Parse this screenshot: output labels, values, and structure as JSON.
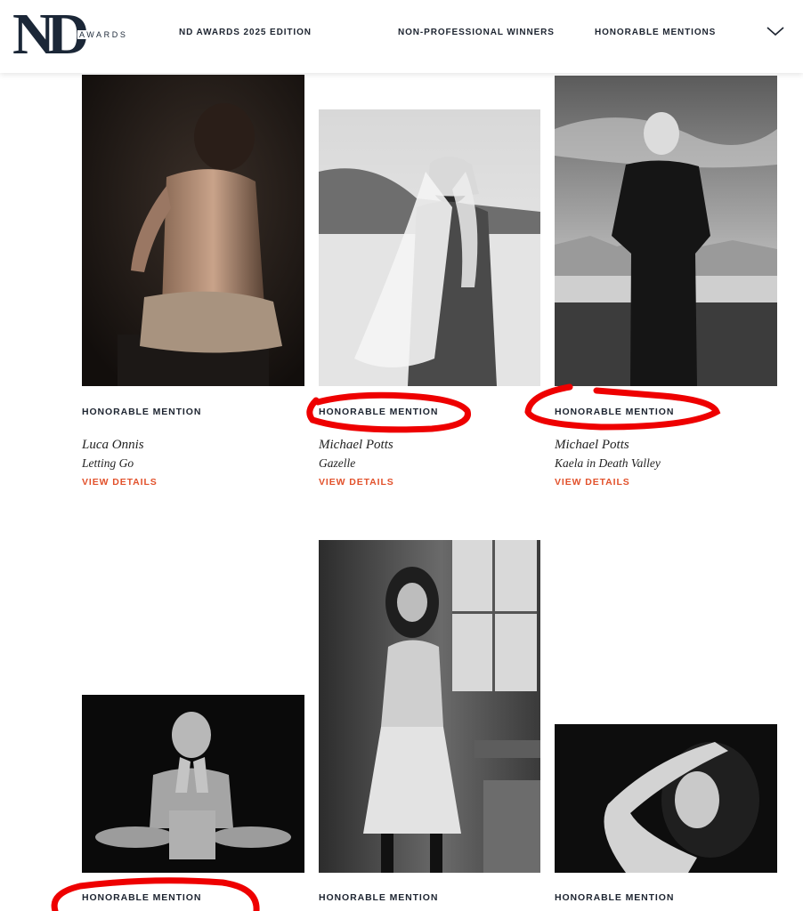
{
  "header": {
    "logo_main": "ND",
    "logo_sub": "AWARDS",
    "nav": [
      "ND AWARDS 2025 EDITION",
      "NON-PROFESSIONAL WINNERS",
      "HONORABLE MENTIONS"
    ],
    "menu_icon": "chevron-down-icon"
  },
  "cards": [
    {
      "label": "HONORABLE MENTION",
      "author": "Luca Onnis",
      "title": "Letting Go",
      "details": "VIEW DETAILS"
    },
    {
      "label": "HONORABLE MENTION",
      "author": "Michael Potts",
      "title": "Gazelle",
      "details": "VIEW DETAILS"
    },
    {
      "label": "HONORABLE MENTION",
      "author": "Michael Potts",
      "title": "Kaela in Death Valley",
      "details": "VIEW DETAILS"
    },
    {
      "label": "HONORABLE MENTION"
    },
    {
      "label": "HONORABLE MENTION"
    },
    {
      "label": "HONORABLE MENTION"
    }
  ],
  "colors": {
    "navy": "#1d2430",
    "accent": "#e2512b",
    "annotation": "#ee0000"
  }
}
